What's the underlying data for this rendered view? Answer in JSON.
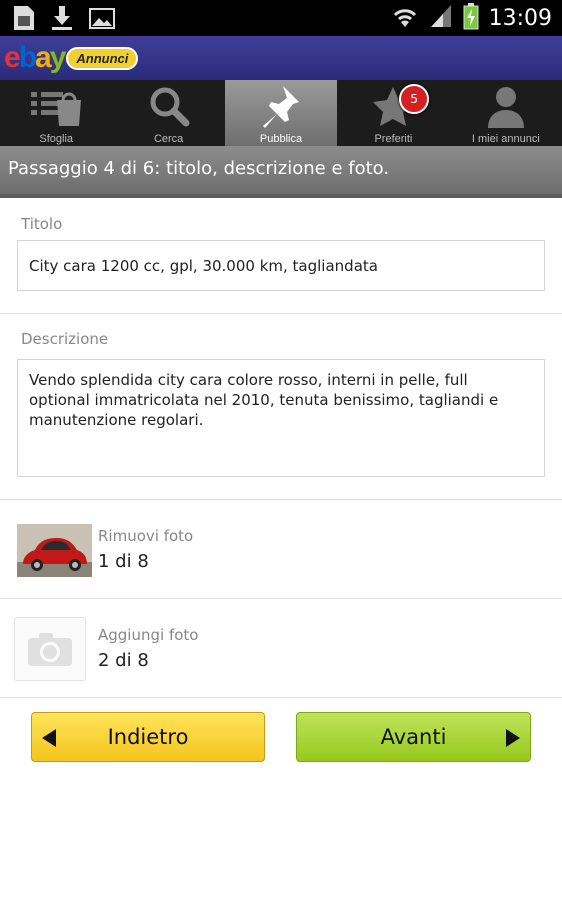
{
  "status_bar": {
    "time": "13:09",
    "left_icons": [
      "sim-icon",
      "download-icon",
      "image-icon"
    ],
    "right_icons": [
      "wifi-icon",
      "signal-icon",
      "battery-charging-icon"
    ]
  },
  "app_bar": {
    "logo_text": "ebay",
    "logo_badge": "Annunci"
  },
  "tabs": [
    {
      "label": "Sfoglia",
      "icon": "browse-bag-icon",
      "active": false
    },
    {
      "label": "Cerca",
      "icon": "search-icon",
      "active": false
    },
    {
      "label": "Pubblica",
      "icon": "pin-icon",
      "active": true
    },
    {
      "label": "Preferiti",
      "icon": "star-icon",
      "active": false,
      "badge": "5"
    },
    {
      "label": "I miei annunci",
      "icon": "user-icon",
      "active": false
    }
  ],
  "step_header": "Passaggio 4 di 6: titolo, descrizione e foto.",
  "form": {
    "title_label": "Titolo",
    "title_value": "City cara 1200 cc, gpl, 30.000 km, tagliandata",
    "description_label": "Descrizione",
    "description_value": "Vendo splendida city cara colore rosso, interni in pelle, full optional immatricolata nel 2010, tenuta benissimo, tagliandi e manutenzione regolari."
  },
  "photos": [
    {
      "action": "Rimuovi foto",
      "count": "1 di 8",
      "icon": "car-photo-thumbnail"
    },
    {
      "action": "Aggiungi foto",
      "count": "2 di 8",
      "icon": "camera-icon"
    }
  ],
  "buttons": {
    "back": "Indietro",
    "next": "Avanti"
  },
  "colors": {
    "app_bar": "#2f2f85",
    "back_button": "#f7cf2e",
    "next_button": "#a6d22f",
    "badge": "#d42020"
  }
}
